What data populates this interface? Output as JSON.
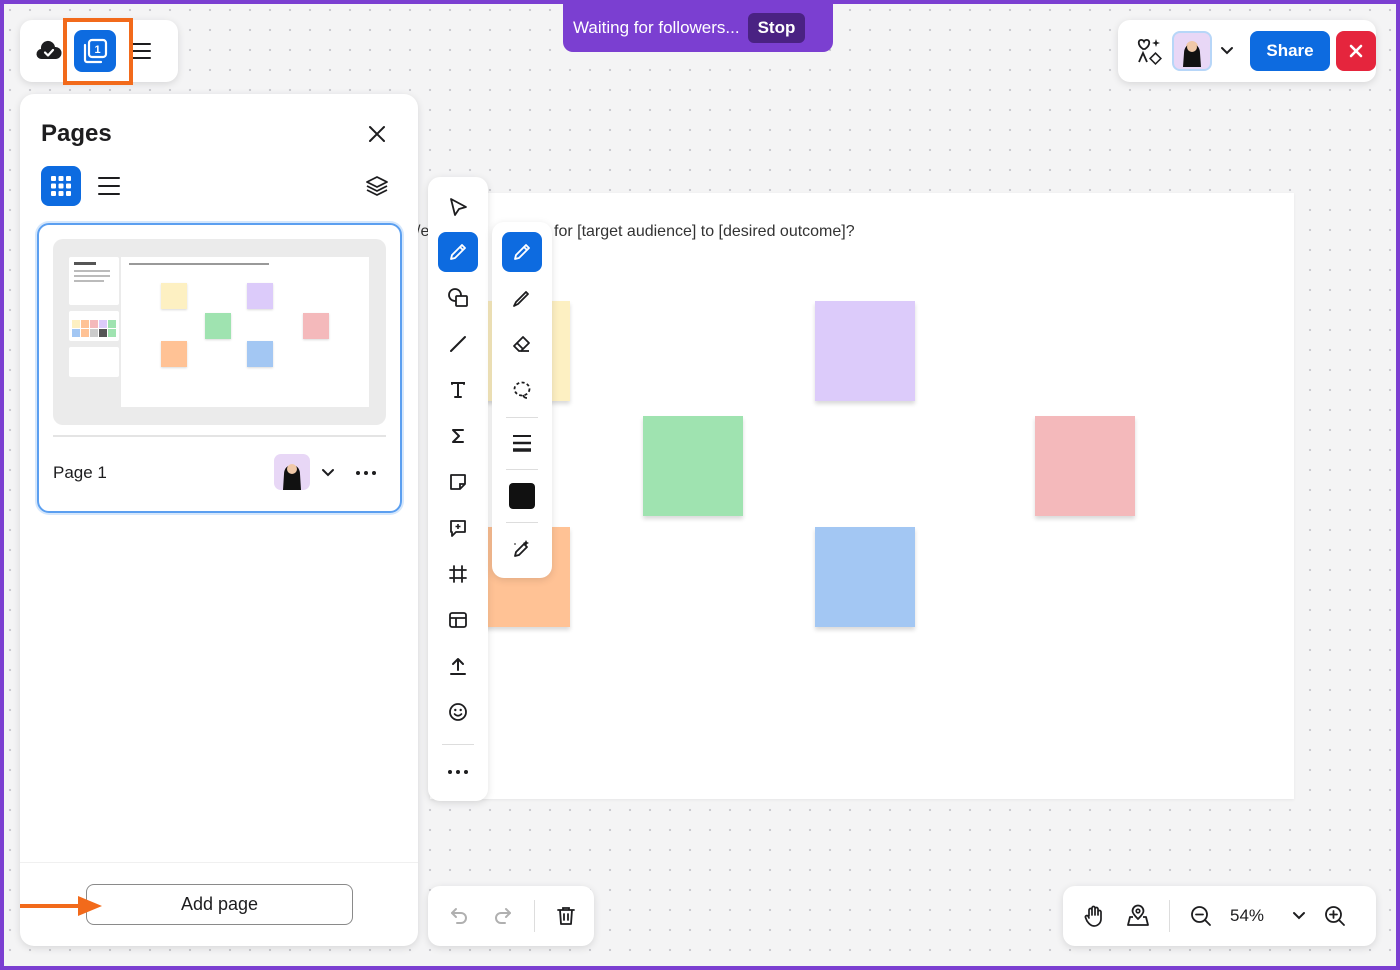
{
  "follow_banner": {
    "text": "Waiting for followers...",
    "stop_label": "Stop"
  },
  "top_right": {
    "share_label": "Share"
  },
  "pages_panel": {
    "title": "Pages",
    "pages": [
      {
        "name": "Page 1"
      }
    ],
    "add_page_label": "Add page"
  },
  "board": {
    "prompt_partial": "/e",
    "prompt": "for [target audience] to [desired outcome]?",
    "sticky_colors": {
      "yellow": "#fdf0c2",
      "purple": "#dccbfa",
      "green": "#9fe3b0",
      "red": "#f4b9bb",
      "orange": "#ffc295",
      "blue": "#a3c7f3"
    }
  },
  "zoom": {
    "level": "54%"
  },
  "colors": {
    "accent": "#0d6be0",
    "follow_purple": "#7b3fd1",
    "stop_bg": "#4a2283",
    "close_red": "#e5253d",
    "annotation_orange": "#f26a1b",
    "selected_pen_color": "#111111"
  }
}
